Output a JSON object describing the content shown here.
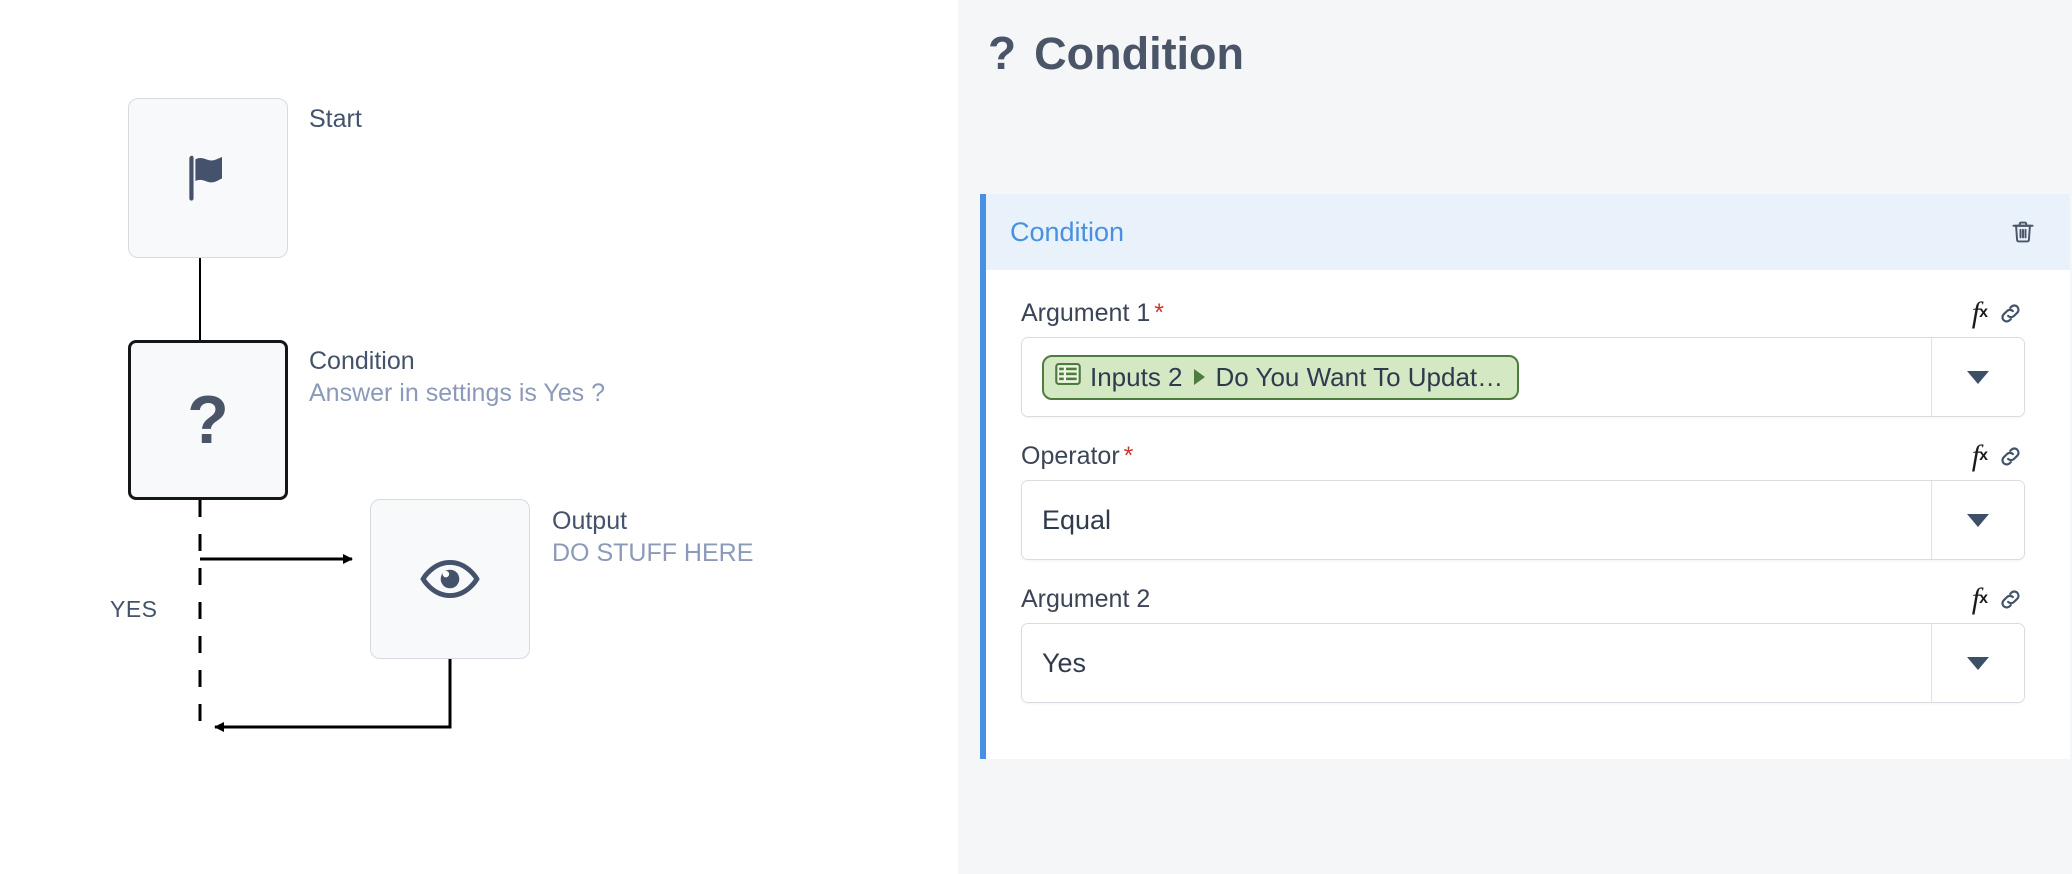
{
  "flow": {
    "nodes": [
      {
        "id": "start",
        "icon": "flag-icon",
        "title": "Start",
        "subtitle": ""
      },
      {
        "id": "condition",
        "icon": "question-mark-icon",
        "title": "Condition",
        "subtitle": "Answer in settings is Yes ?"
      },
      {
        "id": "output",
        "icon": "eye-icon",
        "title": "Output",
        "subtitle": "DO STUFF HERE"
      }
    ],
    "edge_label_yes": "YES"
  },
  "panel": {
    "header": {
      "icon": "?",
      "icon_name": "question-mark-icon",
      "title": "Condition"
    },
    "card": {
      "title": "Condition",
      "delete_icon": "trash-icon",
      "accent_color": "#4790e3",
      "head_bg": "#e9f1fb",
      "fields": [
        {
          "label": "Argument 1",
          "required": true,
          "required_mark": "*",
          "value_type": "token",
          "token": {
            "icon": "list-table-icon",
            "source": "Inputs 2",
            "separator": "▶",
            "name": "Do You Want To Updat…",
            "bg": "#d5e8c4",
            "border": "#4d7c3e"
          },
          "tools": [
            "fx-icon",
            "link-icon"
          ],
          "caret": "chevron-down-icon"
        },
        {
          "label": "Operator",
          "required": true,
          "required_mark": "*",
          "value_type": "text",
          "value": "Equal",
          "tools": [
            "fx-icon",
            "link-icon"
          ],
          "caret": "chevron-down-icon"
        },
        {
          "label": "Argument 2",
          "required": false,
          "required_mark": "",
          "value_type": "text",
          "value": "Yes",
          "tools": [
            "fx-icon",
            "link-icon"
          ],
          "caret": "chevron-down-icon"
        }
      ]
    }
  }
}
